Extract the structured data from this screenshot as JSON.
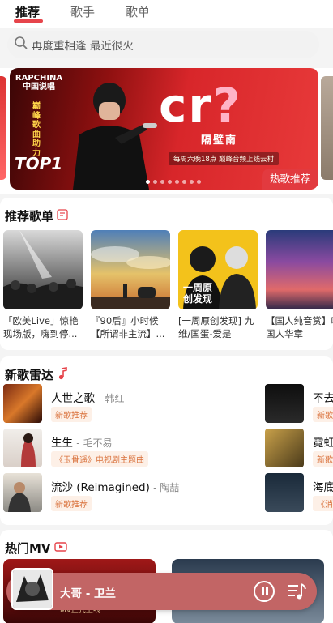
{
  "tabs": [
    {
      "label": "推荐",
      "active": true
    },
    {
      "label": "歌手",
      "active": false
    },
    {
      "label": "歌单",
      "active": false
    }
  ],
  "search": {
    "placeholder": "再度重相逢 最近很火"
  },
  "banner": {
    "logo_text": "RAPCHINA 中国说唱",
    "side_text": "巅峰歌曲助力",
    "top_text": "TOP1",
    "big_text": "cr",
    "big_question": "?",
    "artist": "隔壁南",
    "subtitle": "每周六晚18点 巅峰音频上线云村",
    "badge": "热歌推荐",
    "dot_count": 8
  },
  "playlists_section": {
    "title": "推荐歌单",
    "items": [
      {
        "name": "「欧美Live」惊艳现场版，嗨到停..."
      },
      {
        "name": "『90后』小时候【所谓非主流】..."
      },
      {
        "name": "[一周原创发现] 九维/国蛋-爱是",
        "cover_text": "一周原创发现"
      },
      {
        "name": "【国人纯音赏】听国人华章"
      }
    ]
  },
  "new_songs_section": {
    "title": "新歌雷达",
    "items": [
      {
        "title": "人世之歌",
        "artist": "- 韩红",
        "tag": "新歌推荐"
      },
      {
        "title": "生生",
        "artist": "- 毛不易",
        "tag": "《玉骨遥》电视剧主题曲"
      },
      {
        "title": "流沙 (Reimagined)",
        "artist": "- 陶喆",
        "tag": "新歌推荐"
      },
      {
        "title": "不去",
        "artist": "",
        "tag": "新歌"
      },
      {
        "title": "霓虹",
        "artist": "",
        "tag": "新歌"
      },
      {
        "title": "海底",
        "artist": "",
        "tag": "《消"
      }
    ]
  },
  "mv_section": {
    "title": "热门MV",
    "mv_caption": "MV正式上线"
  },
  "player": {
    "song": "大哥 - 卫兰"
  },
  "colors": {
    "accent": "#e6444b",
    "player_bg": "#c26565",
    "tag_text": "#d9703a"
  }
}
